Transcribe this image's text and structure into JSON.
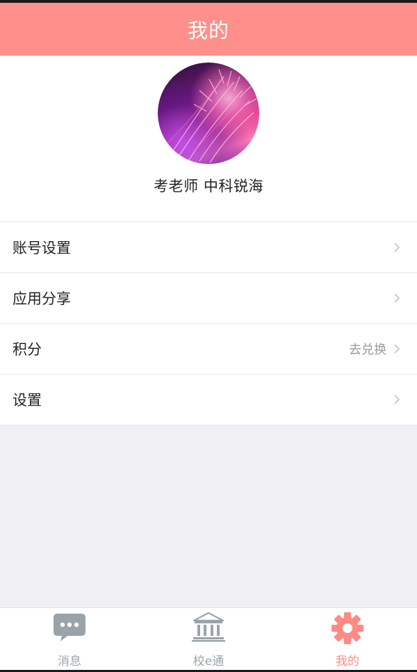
{
  "header": {
    "title": "我的"
  },
  "profile": {
    "name": "考老师  中科锐海"
  },
  "menu": {
    "items": [
      {
        "label": "账号设置",
        "extra": ""
      },
      {
        "label": "应用分享",
        "extra": ""
      },
      {
        "label": "积分",
        "extra": "去兑换"
      },
      {
        "label": "设置",
        "extra": ""
      }
    ]
  },
  "tabbar": {
    "tabs": [
      {
        "label": "消息",
        "icon": "chat-bubble-icon"
      },
      {
        "label": "校e通",
        "icon": "school-building-icon"
      },
      {
        "label": "我的",
        "icon": "gear-icon"
      }
    ],
    "active_color": "#ff8a84",
    "inactive_color": "#9aa4a8"
  },
  "colors": {
    "header": "#ff8f8a",
    "background": "#efeff4"
  }
}
